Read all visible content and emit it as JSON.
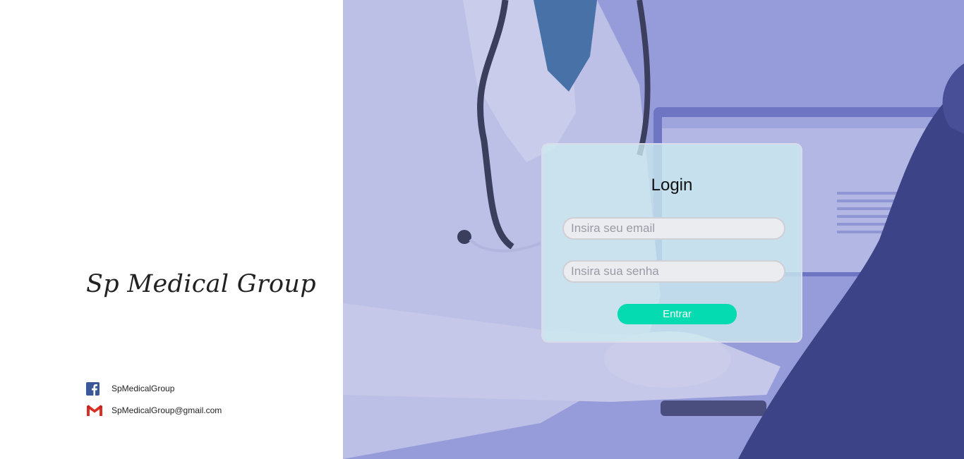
{
  "brand": {
    "title": "Sp Medical Group"
  },
  "contacts": {
    "facebook": {
      "icon": "facebook-icon",
      "label": "SpMedicalGroup"
    },
    "email": {
      "icon": "gmail-icon",
      "label": "SpMedicalGroup@gmail.com"
    }
  },
  "login": {
    "title": "Login",
    "email_placeholder": "Insira seu email",
    "password_placeholder": "Insira sua senha",
    "submit_label": "Entrar"
  },
  "colors": {
    "accent": "#04dbb0",
    "hero_overlay": "#8a90d6",
    "facebook": "#3b5998",
    "gmail": "#d93025"
  }
}
